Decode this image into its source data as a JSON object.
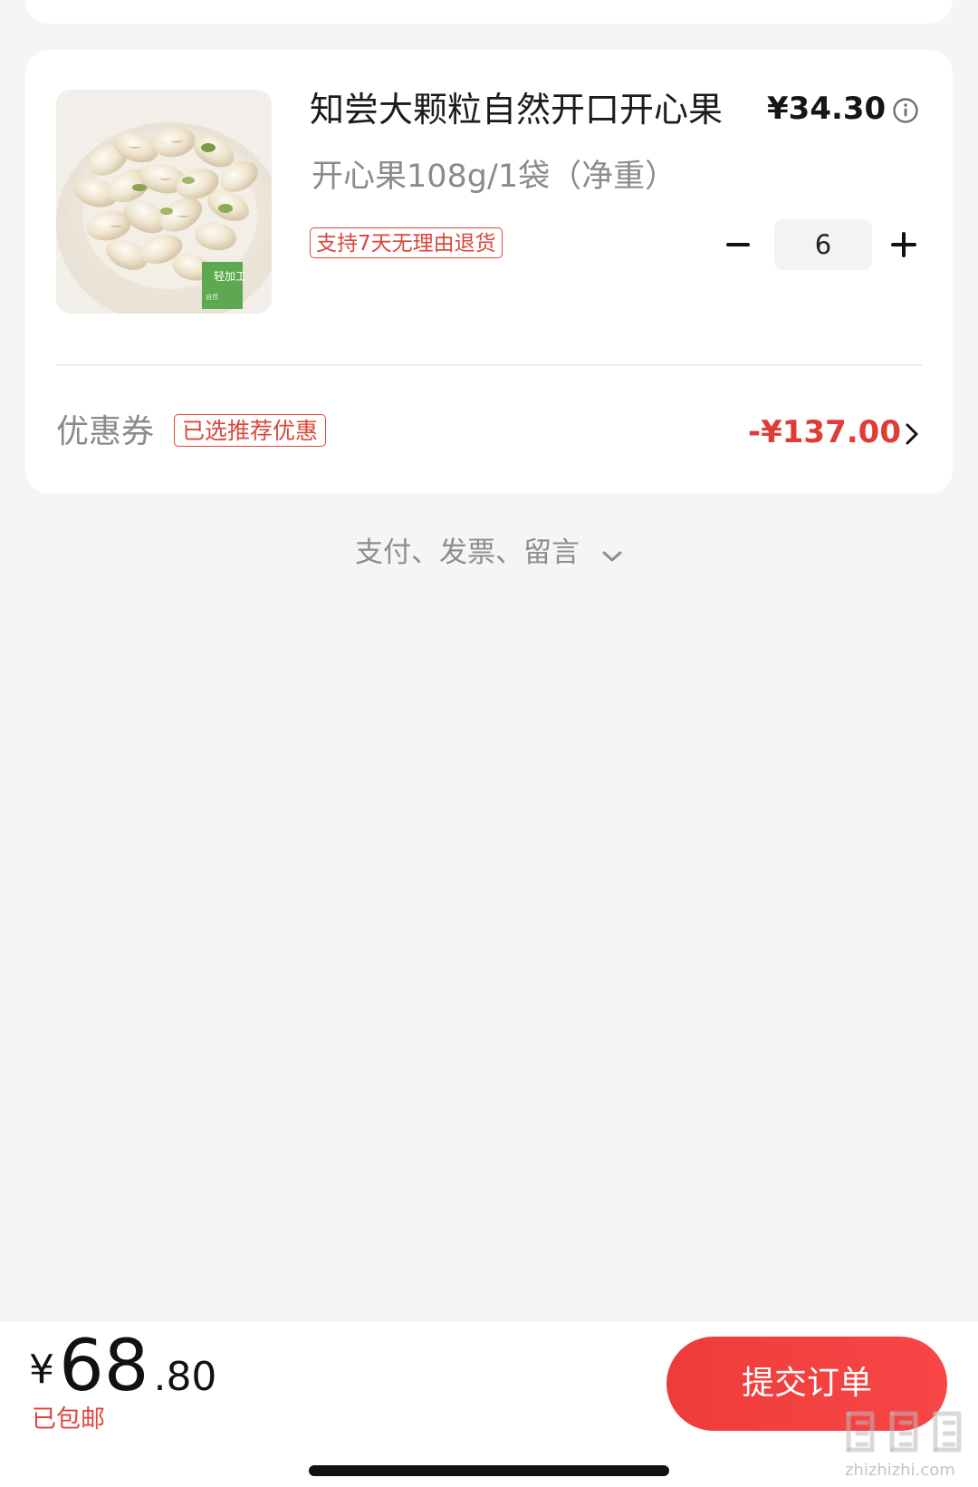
{
  "order_item": {
    "title": "知尝大颗粒自然开口开心果",
    "price": "¥34.30",
    "spec": "开心果108g/1袋（净重）",
    "return_policy": "支持7天无理由退货",
    "quantity": "6",
    "image_badge": "轻加工"
  },
  "coupon": {
    "label": "优惠券",
    "tag": "已选推荐优惠",
    "amount": "-¥137.00"
  },
  "extras": {
    "label": "支付、发票、留言"
  },
  "footer": {
    "currency": "¥",
    "total_integer": "68",
    "total_decimal": ".80",
    "shipping": "已包邮",
    "submit_label": "提交订单"
  },
  "watermark": {
    "text": "zhizhizhi.com"
  },
  "colors": {
    "accent_red": "#e13b35",
    "button_red": "#f13f3f",
    "page_bg": "#f5f5f5"
  },
  "icons": {
    "info": "info-icon",
    "minus": "minus-icon",
    "plus": "plus-icon",
    "chevron_right": "chevron-right-icon",
    "chevron_down": "chevron-down-icon"
  }
}
